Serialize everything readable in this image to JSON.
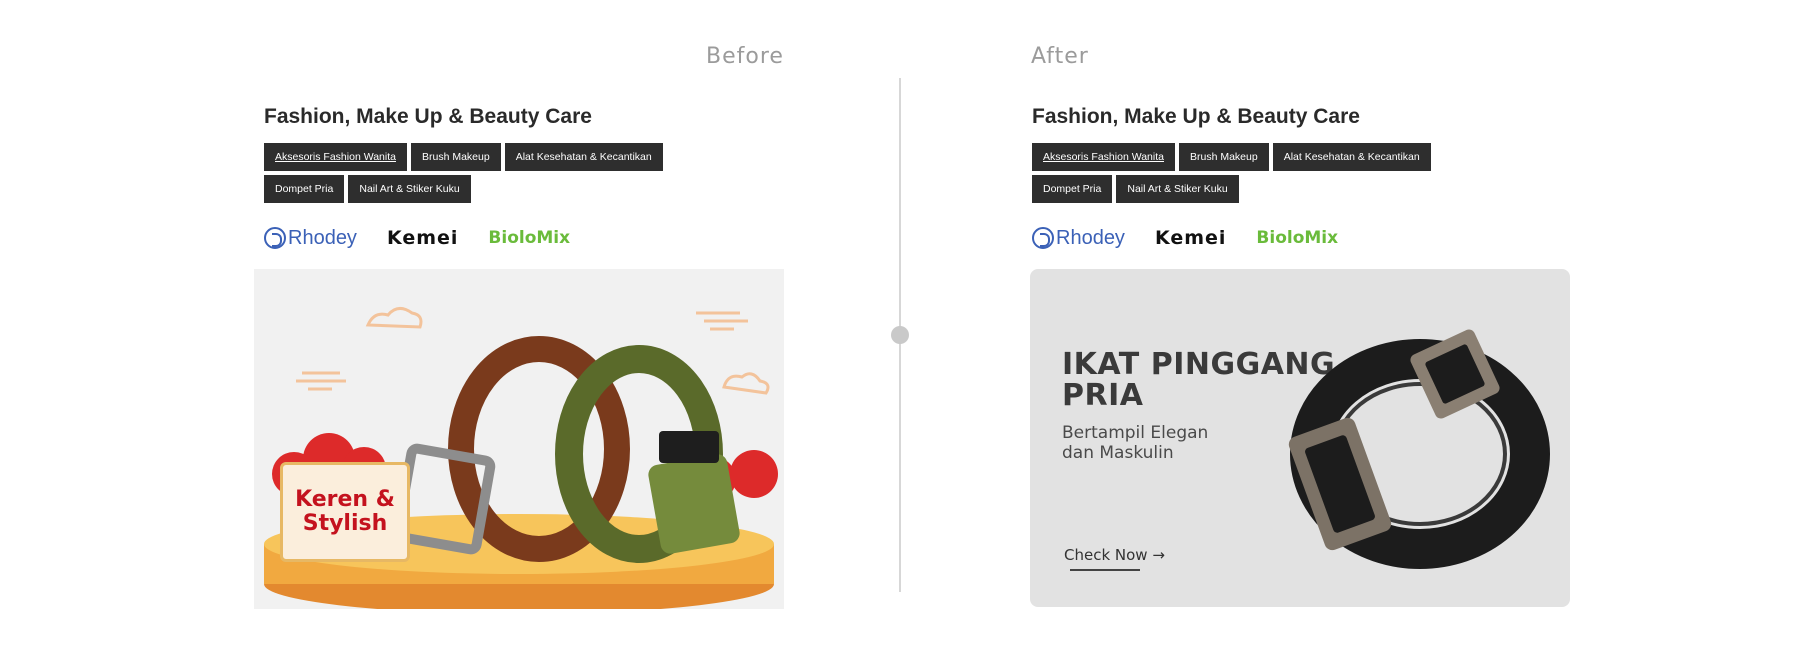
{
  "labels": {
    "before": "Before",
    "after": "After"
  },
  "before": {
    "title": "Fashion, Make Up & Beauty Care",
    "tags": [
      "Aksesoris Fashion Wanita",
      "Brush Makeup",
      "Alat Kesehatan & Kecantikan",
      "Dompet Pria",
      "Nail Art & Stiker Kuku"
    ],
    "brands": [
      "Rhodey",
      "Kemei",
      "BioloMix"
    ],
    "banner": {
      "sign_line1": "Keren &",
      "sign_line2": "Stylish"
    }
  },
  "after": {
    "title": "Fashion, Make Up & Beauty Care",
    "tags": [
      "Aksesoris Fashion Wanita",
      "Brush Makeup",
      "Alat Kesehatan & Kecantikan",
      "Dompet Pria",
      "Nail Art & Stiker Kuku"
    ],
    "brands": [
      "Rhodey",
      "Kemei",
      "BioloMix"
    ],
    "banner": {
      "title_line1": "IKAT PINGGANG",
      "title_line2": "PRIA",
      "subtitle_line1": "Bertampil Elegan",
      "subtitle_line2": "dan Maskulin",
      "cta": "Check Now →"
    }
  }
}
